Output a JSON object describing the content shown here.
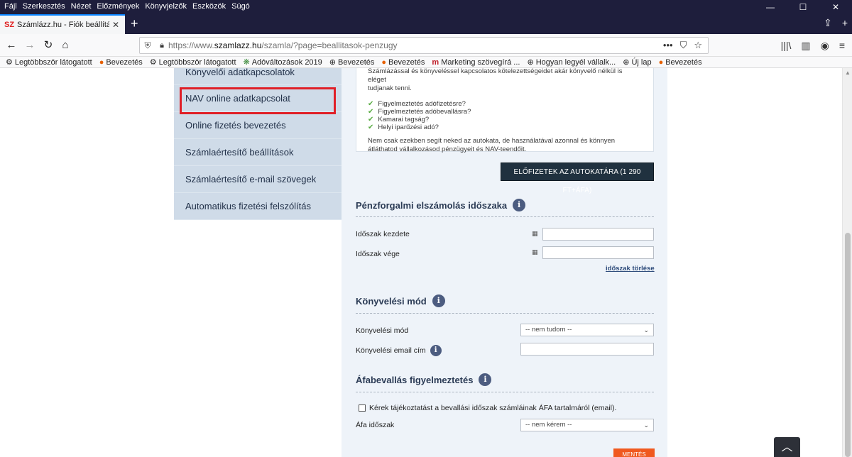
{
  "menubar": {
    "items": [
      "Fájl",
      "Szerkesztés",
      "Nézet",
      "Előzmények",
      "Könyvjelzők",
      "Eszközök",
      "Súgó"
    ]
  },
  "window_controls": {
    "minimize": "—",
    "maximize": "☐",
    "close": "✕"
  },
  "tab": {
    "favicon": "SZ",
    "title": "Számlázz.hu - Fiók beállítások",
    "close": "✕",
    "new_tab": "+"
  },
  "navbar": {
    "back": "←",
    "forward": "→",
    "reload": "↻",
    "home": "⌂",
    "url_prefix": "https://www.",
    "url_domain": "szamlazz.hu",
    "url_path": "/szamla/?page=beallitasok-penzugy",
    "more": "•••",
    "pocket": "⛉",
    "star": "☆",
    "library": "|||\\",
    "sidebar": "▥",
    "account": "◉",
    "menu": "≡"
  },
  "bookmarks": [
    {
      "icon": "gear-icon",
      "glyph": "⚙",
      "label": "Legtöbbször látogatott"
    },
    {
      "icon": "firefox-icon",
      "glyph": "●",
      "label": "Bevezetés"
    },
    {
      "icon": "gear-icon",
      "glyph": "⚙",
      "label": "Legtöbbször látogatott"
    },
    {
      "icon": "tax-icon",
      "glyph": "❋",
      "label": "Adóváltozások 2019"
    },
    {
      "icon": "globe-icon",
      "glyph": "⊕",
      "label": "Bevezetés"
    },
    {
      "icon": "firefox-icon",
      "glyph": "●",
      "label": "Bevezetés"
    },
    {
      "icon": "m-icon",
      "glyph": "m",
      "label": "Marketing szövegírá ..."
    },
    {
      "icon": "globe-icon",
      "glyph": "⊕",
      "label": "Hogyan legyél vállalk..."
    },
    {
      "icon": "globe-icon",
      "glyph": "⊕",
      "label": "Új lap"
    },
    {
      "icon": "firefox-icon",
      "glyph": "●",
      "label": "Bevezetés"
    }
  ],
  "sidebar": {
    "items": [
      "Könyvelői adatkapcsolatok",
      "NAV online adatkapcsolat",
      "Online fizetés bevezetés",
      "Számlaértesítő beállítások",
      "Számlaértesítő e-mail szövegek",
      "Automatikus fizetési felszólítás"
    ]
  },
  "infobox": {
    "intro_line1": "Számlázással és könyveléssel kapcsolatos kötelezettségeidet akár könyvelő nélkül is eléget",
    "intro_line2": "tudjanak tenni.",
    "checks": [
      "Figyelmeztetés adófizetésre?",
      "Figyelmeztetés adóbevallásra?",
      "Kamarai tagság?",
      "Helyi iparűzési adó?"
    ],
    "outro": "Nem csak ezekben segít neked az autokata, de használatával azonnal és könnyen átláthatod vállalkozásod pénzügyeit és NAV-teendőit."
  },
  "subscribe_button": "ELŐFIZETEK AZ AUTOKATÁRA (1 290 FT+ÁFA)",
  "section_period": {
    "title": "Pénzforgalmi elszámolás időszaka",
    "start_label": "Időszak kezdete",
    "end_label": "Időszak vége",
    "start_value": "",
    "end_value": "",
    "clear_link": "időszak törlése"
  },
  "section_accounting": {
    "title": "Könyvelési mód",
    "mode_label": "Könyvelési mód",
    "mode_value": "-- nem tudom --",
    "email_label": "Könyvelési email cím",
    "email_value": ""
  },
  "section_vat": {
    "title": "Áfabevallás figyelmeztetés",
    "checkbox_label": "Kérek tájékoztatást a bevallási időszak számláinak ÁFA tartalmáról (email).",
    "checkbox_checked": false,
    "period_label": "Áfa időszak",
    "period_value": "-- nem kérem --"
  },
  "save_button": "MENTÉS",
  "scroll_top": "︿",
  "icons": {
    "info": "i",
    "calendar": "▦",
    "chevron": "⌄",
    "check": "✔"
  }
}
